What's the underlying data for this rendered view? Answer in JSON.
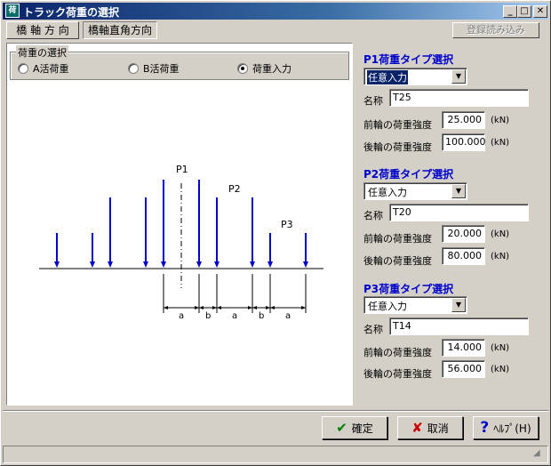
{
  "window": {
    "title": "トラック荷重の選択",
    "icon_name": "app-icon",
    "icon_text": "荷"
  },
  "titlebar_buttons": {
    "minimize": "_",
    "maximize": "□",
    "close": "✕"
  },
  "tabs": [
    {
      "label": "橋 軸 方 向"
    },
    {
      "label": "橋軸直角方向"
    }
  ],
  "toolbar": {
    "load_registered_label": "登録読み込み"
  },
  "load_selection": {
    "group_label": "荷重の選択",
    "options": [
      {
        "label": "A活荷重",
        "selected": false
      },
      {
        "label": "B活荷重",
        "selected": false
      },
      {
        "label": "荷重入力",
        "selected": true
      }
    ]
  },
  "diagram": {
    "labels": {
      "p1": "P1",
      "p2": "P2",
      "p3": "P3"
    },
    "dims": [
      "a",
      "b",
      "a",
      "b",
      "a"
    ]
  },
  "p1": {
    "title": "P1荷重タイプ選択",
    "type_value": "任意入力",
    "name_label": "名称",
    "name_value": "T25",
    "front_label": "前輪の荷重強度",
    "front_value": "25.000",
    "rear_label": "後輪の荷重強度",
    "rear_value": "100.000",
    "unit": "(kN)"
  },
  "p2": {
    "title": "P2荷重タイプ選択",
    "type_value": "任意入力",
    "name_label": "名称",
    "name_value": "T20",
    "front_label": "前輪の荷重強度",
    "front_value": "20.000",
    "rear_label": "後輪の荷重強度",
    "rear_value": "80.000",
    "unit": "(kN)"
  },
  "p3": {
    "title": "P3荷重タイプ選択",
    "type_value": "任意入力",
    "name_label": "名称",
    "name_value": "T14",
    "front_label": "前輪の荷重強度",
    "front_value": "14.000",
    "rear_label": "後輪の荷重強度",
    "rear_value": "56.000",
    "unit": "(kN)"
  },
  "buttons": {
    "ok_label": "確定",
    "cancel_label": "取消",
    "help_label": "ﾍﾙﾌﾟ(H)",
    "ok_color": "#008000",
    "cancel_color": "#cc0000",
    "help_color": "#0000cc"
  },
  "colors": {
    "arrow": "#0000cc",
    "title_accent": "#0000cc",
    "titlebar": "#0a246a"
  }
}
